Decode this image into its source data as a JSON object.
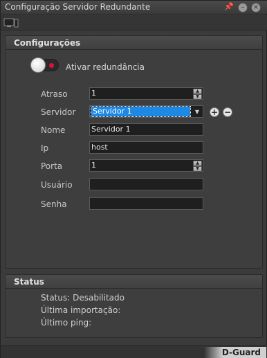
{
  "window": {
    "title": "Configuração Servidor Redundante"
  },
  "config": {
    "header": "Configurações",
    "toggle_label": "Ativar redundância",
    "fields": {
      "atraso": {
        "label": "Atraso",
        "value": "1"
      },
      "servidor": {
        "label": "Servidor",
        "value": "Servidor 1"
      },
      "nome": {
        "label": "Nome",
        "value": "Servidor 1"
      },
      "ip": {
        "label": "Ip",
        "value": "host"
      },
      "porta": {
        "label": "Porta",
        "value": "1"
      },
      "usuario": {
        "label": "Usuário",
        "value": ""
      },
      "senha": {
        "label": "Senha",
        "value": ""
      }
    }
  },
  "status": {
    "header": "Status",
    "line1": "Status: Desabilitado",
    "line2": "Última importação:",
    "line3": "Último ping:"
  },
  "footer": {
    "brand": "D-Guard"
  },
  "colors": {
    "accent": "#1e88e5",
    "toggle_dot": "#e0103a"
  },
  "icons": [
    "pin-icon",
    "minimize-icon",
    "close-icon",
    "monitor-icon",
    "add-icon",
    "remove-icon"
  ]
}
